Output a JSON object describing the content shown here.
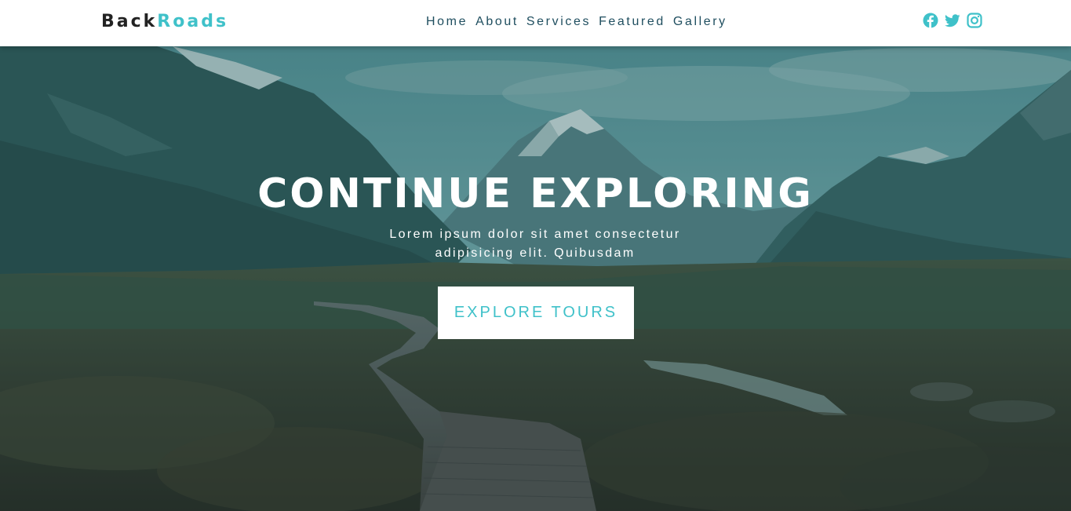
{
  "brand": {
    "part1": "Back",
    "part2": "Roads"
  },
  "nav": {
    "links": [
      "Home",
      "About",
      "Services",
      "Featured",
      "Gallery"
    ]
  },
  "socials": [
    "facebook-icon",
    "twitter-icon",
    "instagram-icon"
  ],
  "hero": {
    "title": "CONTINUE EXPLORING",
    "subtitle_line1": "Lorem ipsum dolor sit amet consectetur",
    "subtitle_line2": "adipisicing elit. Quibusdam",
    "cta_label": "EXPLORE TOURS"
  },
  "colors": {
    "accent": "#3fc1c9",
    "nav_text": "#1f4e5f",
    "logo_dark": "#222222"
  }
}
